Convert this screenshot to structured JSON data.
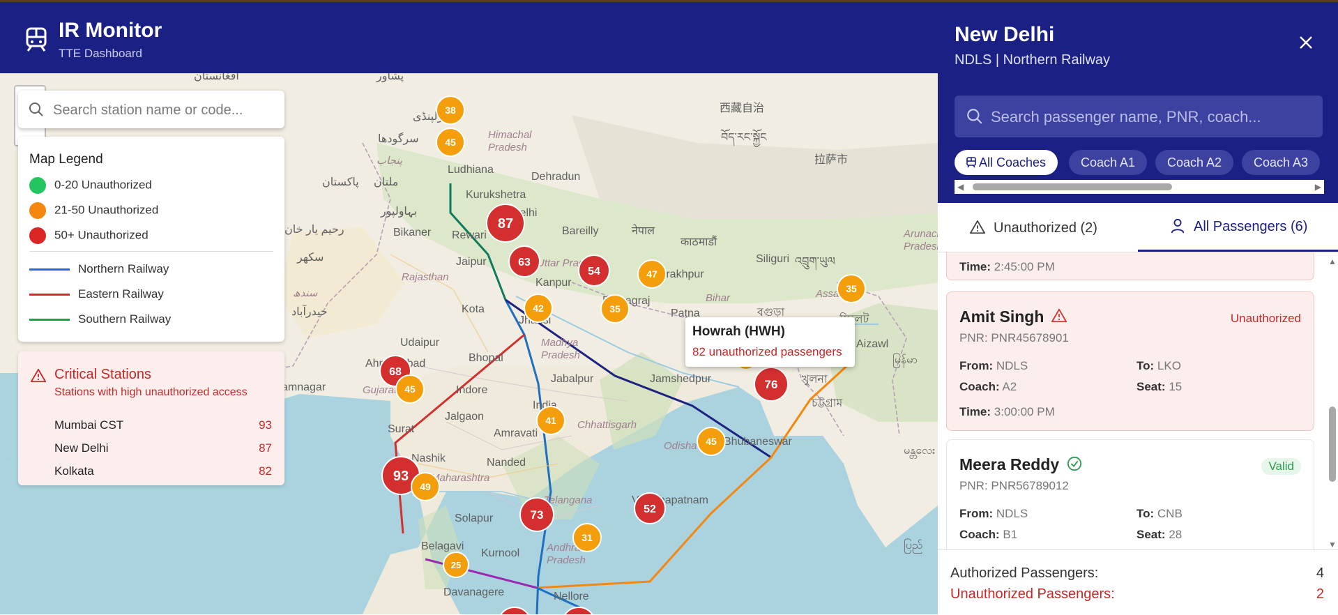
{
  "app": {
    "title": "IR Monitor",
    "subtitle": "TTE Dashboard"
  },
  "map": {
    "search_placeholder": "Search station name or code...",
    "zoom_minus": "−",
    "legend": {
      "title": "Map Legend",
      "levels": [
        {
          "label": "0-20 Unauthorized",
          "color": "#22c55e"
        },
        {
          "label": "21-50 Unauthorized",
          "color": "#f5870f"
        },
        {
          "label": "50+ Unauthorized",
          "color": "#dc2626"
        }
      ],
      "zones": [
        {
          "label": "Northern Railway",
          "color": "#2563eb"
        },
        {
          "label": "Eastern Railway",
          "color": "#dc2626"
        },
        {
          "label": "Southern Railway",
          "color": "#16a34a"
        }
      ]
    },
    "critical": {
      "title": "Critical Stations",
      "subtitle": "Stations with high unauthorized access",
      "stations": [
        {
          "name": "Mumbai CST",
          "value": "93"
        },
        {
          "name": "New Delhi",
          "value": "87"
        },
        {
          "name": "Kolkata",
          "value": "82"
        }
      ]
    },
    "tooltip": {
      "station": "Howrah (HWH)",
      "detail": "82 unauthorized passengers"
    },
    "markers": [
      "38",
      "45",
      "87",
      "63",
      "54",
      "47",
      "42",
      "35",
      "68",
      "45",
      "41",
      "93",
      "49",
      "73",
      "52",
      "45",
      "76",
      "35",
      "31",
      "25"
    ],
    "place_labels": {
      "afghanistan": "افغانستان",
      "peshawar": "پشاور",
      "rawalpindi": "راولپنڈی",
      "sargodha": "سرگودھا",
      "punjab": "پنجاب",
      "multan": "ملتان",
      "bahawalpur": "بہاولپور",
      "rahim_yar_khan": "رحیم یار خان",
      "pakistan": "پاکستان",
      "sukkur": "سکھر",
      "sindh": "سندھ",
      "hyderabad": "حیدرآباد",
      "ludhiana": "Ludhiana",
      "himachal": "Himachal Pradesh",
      "dehradun": "Dehradun",
      "kurukshetra": "Kurukshetra",
      "delhi": "Delhi",
      "bikaner": "Bikaner",
      "rewari": "Rewari",
      "jaipur": "Jaipur",
      "bareilly": "Bareilly",
      "nepal": "नेपाल",
      "kathmandu": "काठमाडौं",
      "rajasthan": "Rajasthan",
      "uttar_pradesh": "Uttar Pradesh",
      "kanpur": "Kanpur",
      "gorakhpur": "Gorakhpur",
      "kota": "Kota",
      "prayagraj": "Prayagraj",
      "patna": "Patna",
      "bihar": "Bihar",
      "siliguri": "Siliguri",
      "bhutan": "འབྲུག་ཡུལ",
      "jhansi": "Jhansi",
      "udaipur": "Udaipur",
      "madhya_pradesh": "Madhya Pradesh",
      "bhopal": "Bhopal",
      "ahmedabad": "Ahmedabad",
      "jabalpur": "Jabalpur",
      "jamshedpur": "Jamshedpur",
      "gujarat": "Gujarat",
      "jamnagar": "amnagar",
      "indore": "Indore",
      "india": "India",
      "chhattisgarh": "Chhattisgarh",
      "jalgaon": "Jalgaon",
      "amravati": "Amravati",
      "surat": "Surat",
      "nashik": "Nashik",
      "maharashtra": "Maharashtra",
      "nanded": "Nanded",
      "odisha": "Odisha",
      "bhubaneswar": "Bhubaneswar",
      "visakhapatnam": "Visakhapatnam",
      "telangana": "Telangana",
      "solapur": "Solapur",
      "belagavi": "Belagavi",
      "kurnool": "Kurnool",
      "andhra": "Andhra Pradesh",
      "davanagere": "Davanagere",
      "nellore": "Nellore",
      "xizang": "西藏自治",
      "tibet": "བོད་རང་སྐྱོང",
      "lhasa": "拉萨市",
      "assam": "Assam",
      "arunachal": "Arunachal Pradesh",
      "aizawl": "Aizawl",
      "khulna": "খুলনা",
      "chattogram": "চট্টগ্রাম",
      "bangladesh_sylhet": "সিলেট",
      "myanmar": "မြန်မာ",
      "mandalay": "မန္တလေး",
      "yangon": "ပြည်",
      "bogura": "বগুড়া"
    }
  },
  "panel": {
    "station_name": "New Delhi",
    "station_info": "NDLS | Northern Railway",
    "search_placeholder": "Search passenger name, PNR, coach...",
    "chips": [
      "All Coaches",
      "Coach A1",
      "Coach A2",
      "Coach A3"
    ],
    "tabs": [
      {
        "label": "Unauthorized (2)",
        "icon": "warning-icon"
      },
      {
        "label": "All Passengers (6)",
        "icon": "user-icon"
      }
    ],
    "labels": {
      "from": "From:",
      "to": "To:",
      "coach": "Coach:",
      "seat": "Seat:",
      "time": "Time:"
    },
    "partial_card": {
      "time": "2:45:00 PM"
    },
    "passengers": [
      {
        "name": "Amit Singh",
        "pnr": "PNR: PNR45678901",
        "status": "Unauthorized",
        "from": "NDLS",
        "to": "LKO",
        "coach": "A2",
        "seat": "15",
        "time": "3:00:00 PM"
      },
      {
        "name": "Meera Reddy",
        "pnr": "PNR: PNR56789012",
        "status": "Valid",
        "from": "NDLS",
        "to": "CNB",
        "coach": "B1",
        "seat": "28"
      }
    ],
    "summary": {
      "authorized_label": "Authorized Passengers:",
      "authorized_value": "4",
      "unauthorized_label": "Unauthorized Passengers:",
      "unauthorized_value": "2"
    }
  }
}
